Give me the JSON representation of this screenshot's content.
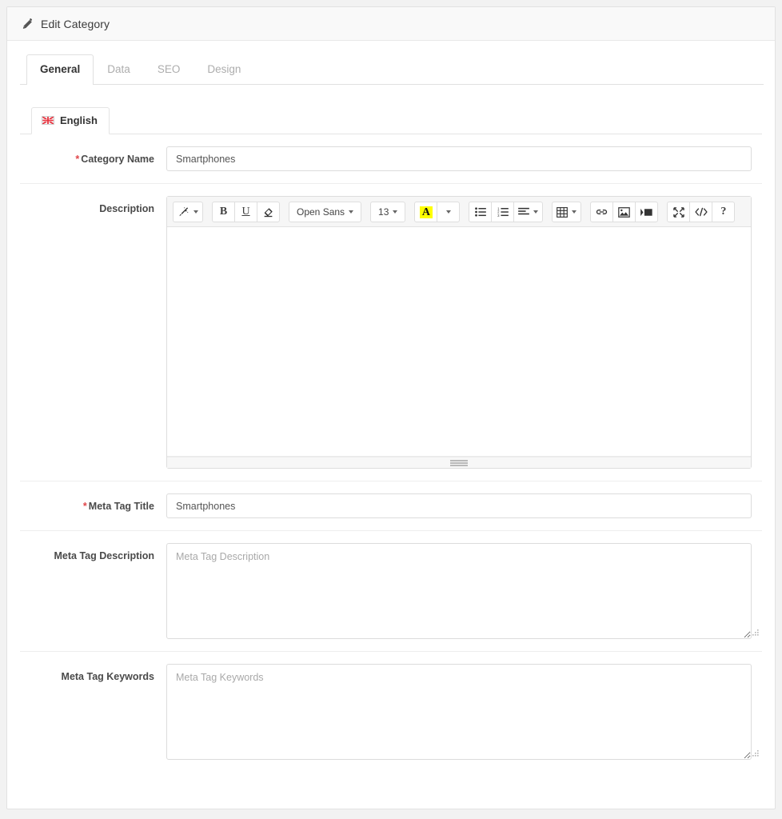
{
  "panel": {
    "title": "Edit Category",
    "title_icon": "pencil-icon"
  },
  "tabs": [
    {
      "label": "General",
      "active": true
    },
    {
      "label": "Data",
      "active": false
    },
    {
      "label": "SEO",
      "active": false
    },
    {
      "label": "Design",
      "active": false
    }
  ],
  "language_tabs": [
    {
      "label": "English",
      "flag": "uk-flag-icon",
      "active": true
    }
  ],
  "form": {
    "category_name": {
      "label": "Category Name",
      "required": true,
      "value": "Smartphones",
      "placeholder": "Category Name"
    },
    "description": {
      "label": "Description",
      "required": false,
      "value": ""
    },
    "meta_tag_title": {
      "label": "Meta Tag Title",
      "required": true,
      "value": "Smartphones",
      "placeholder": "Meta Tag Title"
    },
    "meta_tag_description": {
      "label": "Meta Tag Description",
      "required": false,
      "value": "",
      "placeholder": "Meta Tag Description"
    },
    "meta_tag_keywords": {
      "label": "Meta Tag Keywords",
      "required": false,
      "value": "",
      "placeholder": "Meta Tag Keywords"
    }
  },
  "editor_toolbar": {
    "groups": [
      {
        "buttons": [
          {
            "name": "style-magic-icon",
            "label": "",
            "type": "icon-caret"
          }
        ]
      },
      {
        "buttons": [
          {
            "name": "bold-button",
            "label": "B",
            "type": "bold"
          },
          {
            "name": "underline-button",
            "label": "U",
            "type": "underline"
          },
          {
            "name": "remove-format-icon",
            "label": "",
            "type": "icon"
          }
        ]
      },
      {
        "buttons": [
          {
            "name": "font-family-select",
            "label": "Open Sans",
            "type": "text-caret"
          }
        ]
      },
      {
        "buttons": [
          {
            "name": "font-size-select",
            "label": "13",
            "type": "text-caret"
          }
        ]
      },
      {
        "buttons": [
          {
            "name": "font-color-button",
            "label": "A",
            "type": "color"
          },
          {
            "name": "font-color-dropdown",
            "label": "",
            "type": "caret-only"
          }
        ]
      },
      {
        "buttons": [
          {
            "name": "unordered-list-icon",
            "label": "",
            "type": "icon"
          },
          {
            "name": "ordered-list-icon",
            "label": "",
            "type": "icon"
          },
          {
            "name": "paragraph-align-icon",
            "label": "",
            "type": "icon-caret"
          }
        ]
      },
      {
        "buttons": [
          {
            "name": "table-icon",
            "label": "",
            "type": "icon-caret"
          }
        ]
      },
      {
        "buttons": [
          {
            "name": "link-icon",
            "label": "",
            "type": "icon"
          },
          {
            "name": "picture-icon",
            "label": "",
            "type": "icon"
          },
          {
            "name": "video-icon",
            "label": "",
            "type": "icon"
          }
        ]
      },
      {
        "buttons": [
          {
            "name": "fullscreen-icon",
            "label": "",
            "type": "icon"
          },
          {
            "name": "code-view-icon",
            "label": "",
            "type": "icon"
          },
          {
            "name": "help-button",
            "label": "?",
            "type": "help"
          }
        ]
      }
    ],
    "font_family": "Open Sans",
    "font_size": "13",
    "color_swatch": "#ffff00"
  },
  "colors": {
    "page_bg": "#f2f2f2",
    "panel_bg": "#ffffff",
    "heading_bg": "#f9f9f9",
    "border": "#e2e2e2",
    "required": "#e0464a",
    "toolbar_bg": "#f6f6f6",
    "active_tab_text": "#333333",
    "inactive_tab_text": "#adadad"
  }
}
